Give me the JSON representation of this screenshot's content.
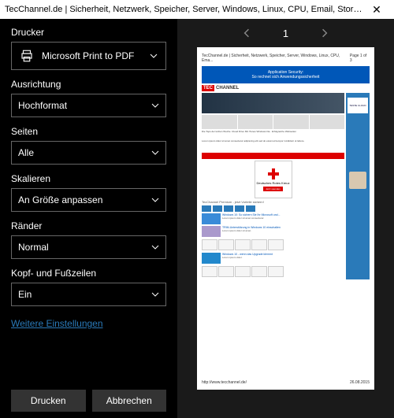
{
  "titlebar": {
    "title": "TecChannel.de | Sicherheit, Netzwerk, Speicher, Server, Windows, Linux, CPU, Email, Storage – Drucken"
  },
  "sidebar": {
    "printer": {
      "label": "Drucker",
      "value": "Microsoft Print to PDF"
    },
    "orientation": {
      "label": "Ausrichtung",
      "value": "Hochformat"
    },
    "pages": {
      "label": "Seiten",
      "value": "Alle"
    },
    "scale": {
      "label": "Skalieren",
      "value": "An Größe anpassen"
    },
    "margins": {
      "label": "Ränder",
      "value": "Normal"
    },
    "headers": {
      "label": "Kopf- und Fußzeilen",
      "value": "Ein"
    },
    "more": "Weitere Einstellungen",
    "print_btn": "Drucken",
    "cancel_btn": "Abbrechen"
  },
  "preview": {
    "current_page": "1",
    "page_header_left": "TecChannel.de | Sicherheit, Netzwerk, Speicher, Server, Windows, Linux, CPU, Ema...",
    "page_header_right": "Page 1 of 3",
    "page_footer_left": "http://www.tecchannel.de/",
    "page_footer_right": "26.08.2015",
    "banner_line1": "Application Security:",
    "banner_line2": "So rechnet sich Anwendungssicherheit",
    "logo_red": "TEC",
    "logo_rest": "CHANNEL",
    "side_cloud": "TESTE CLOUD",
    "drk_text": "Deutsches Rotes Kreuz",
    "drk_btn": "Jetzt spenden",
    "premium_title": "TecChannel Premium - jetzt Vorteile sichern!"
  }
}
